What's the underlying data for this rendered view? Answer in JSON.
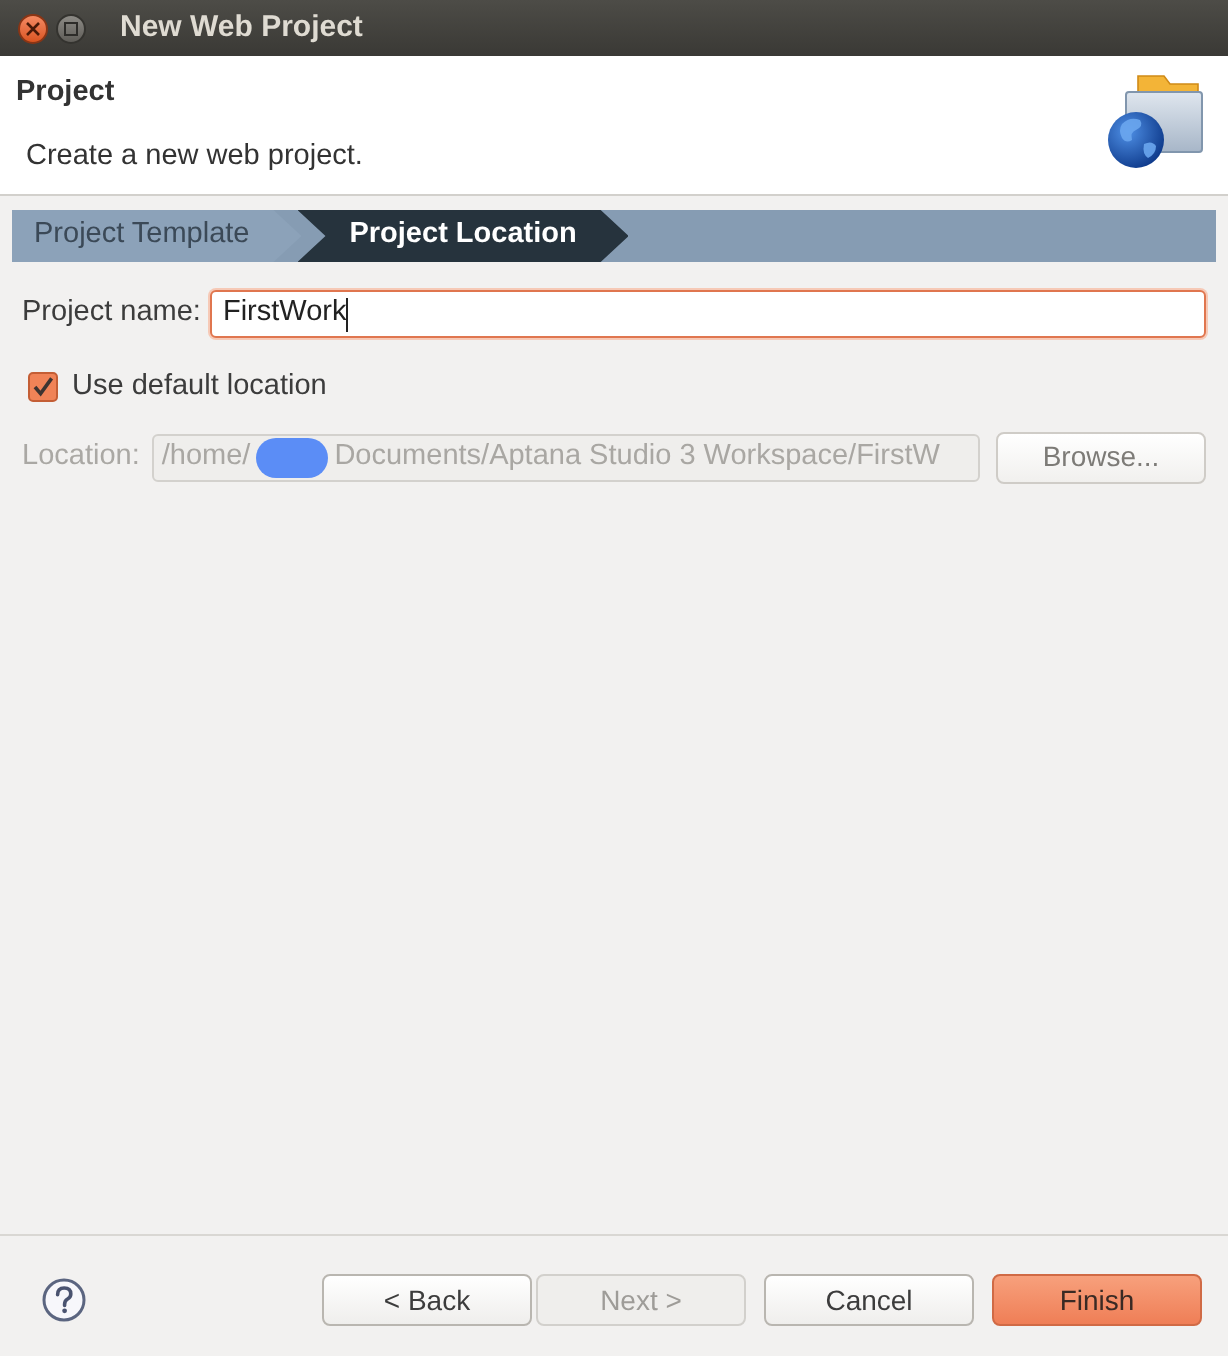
{
  "window": {
    "title": "New Web Project"
  },
  "header": {
    "title": "Project",
    "description": "Create a new web project."
  },
  "steps": [
    {
      "label": "Project Template",
      "selected": false
    },
    {
      "label": "Project Location",
      "selected": true
    }
  ],
  "project_name": {
    "label": "Project name:",
    "value": "FirstWork",
    "focused": true
  },
  "use_default_location": {
    "label": "Use default location",
    "checked": true
  },
  "location": {
    "label": "Location:",
    "value_before": "/home/",
    "value_after": "Documents/Aptana Studio 3 Workspace/FirstW",
    "redacted": true,
    "disabled": true
  },
  "browse_button": {
    "label": "Browse...",
    "disabled": true
  },
  "nav_buttons": [
    {
      "label": "< Back",
      "disabled": false
    },
    {
      "label": "Next >",
      "disabled": true
    }
  ],
  "action_buttons": [
    {
      "label": "Cancel",
      "default": false
    },
    {
      "label": "Finish",
      "default": true
    }
  ]
}
